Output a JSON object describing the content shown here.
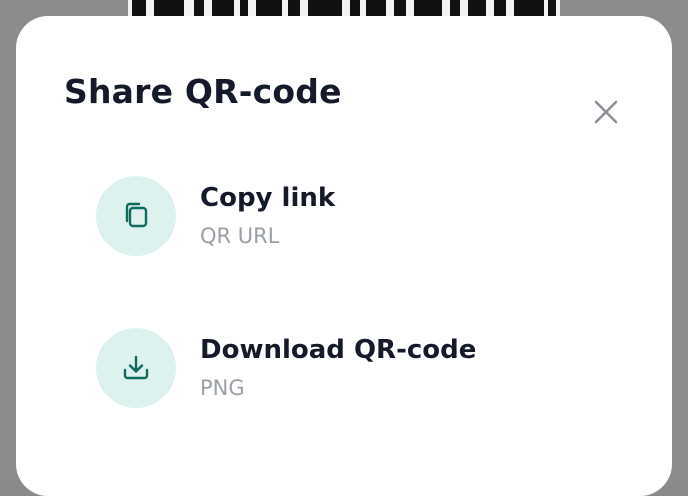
{
  "colors": {
    "accent": "#0f6b5e",
    "icon_bg": "#ddf1ee",
    "title_text": "#151a2a",
    "muted_text": "#9aa0a6",
    "close_icon": "#8a9099"
  },
  "modal": {
    "title": "Share QR-code",
    "close_icon": "close-icon"
  },
  "options": [
    {
      "title": "Copy link",
      "subtitle": "QR URL",
      "icon": "copy-icon"
    },
    {
      "title": "Download QR-code",
      "subtitle": "PNG",
      "icon": "download-icon"
    }
  ]
}
